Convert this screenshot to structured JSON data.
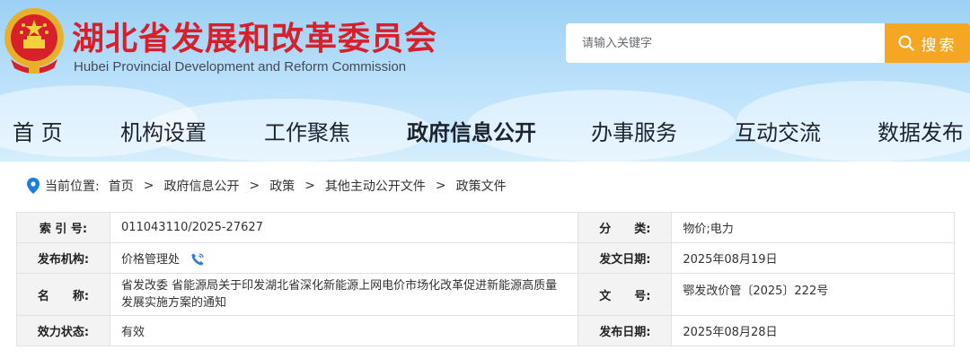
{
  "header": {
    "title": "湖北省发展和改革委员会",
    "subtitle": "Hubei Provincial Development and Reform Commission",
    "emblem_icon": "national-emblem",
    "search": {
      "placeholder": "请输入关键字",
      "button_label": "搜索",
      "button_color": "#f5a623"
    },
    "brand_color": "#d7202a"
  },
  "nav": {
    "items": [
      {
        "label": "首 页"
      },
      {
        "label": "机构设置"
      },
      {
        "label": "工作聚焦"
      },
      {
        "label": "政府信息公开",
        "active": true
      },
      {
        "label": "办事服务"
      },
      {
        "label": "互动交流"
      },
      {
        "label": "数据发布"
      }
    ]
  },
  "breadcrumb": {
    "prefix": "当前位置:",
    "items": [
      "首页",
      "政府信息公开",
      "政策",
      "其他主动公开文件",
      "政策文件"
    ],
    "separator": ">"
  },
  "info": {
    "index_label": "索 引 号:",
    "index_value": "011043110/2025-27627",
    "category_label": "分　　类:",
    "category_value": "物价;电力",
    "issuer_label": "发布机构:",
    "issuer_value": "价格管理处",
    "doc_date_label": "发文日期:",
    "doc_date_value": "2025年08月19日",
    "name_label": "名　　称:",
    "name_value": "省发改委 省能源局关于印发湖北省深化新能源上网电价市场化改革促进新能源高质量发展实施方案的通知",
    "doc_no_label": "文　　号:",
    "doc_no_value": "鄂发改价管〔2025〕222号",
    "status_label": "效力状态:",
    "status_value": "有效",
    "pub_date_label": "发布日期:",
    "pub_date_value": "2025年08月28日"
  }
}
